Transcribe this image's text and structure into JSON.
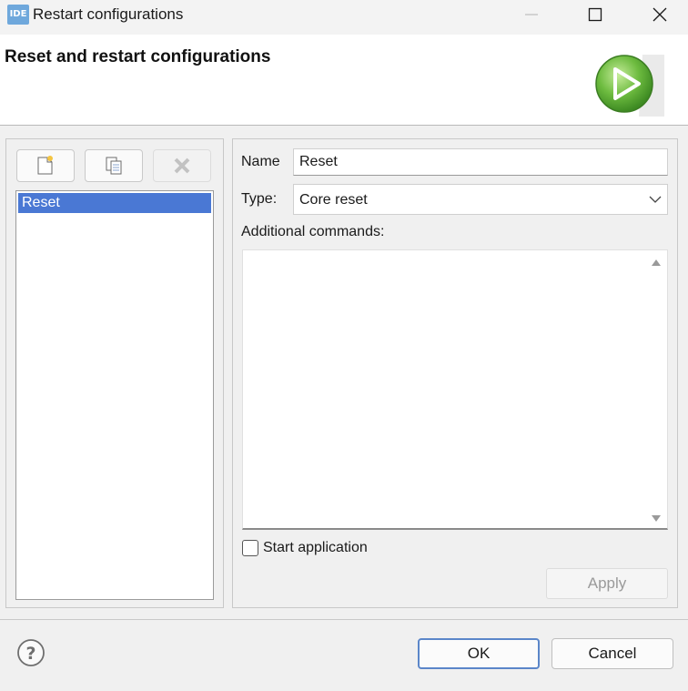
{
  "window": {
    "app_icon_text": "IDE",
    "title": "Restart configurations"
  },
  "header": {
    "title": "Reset and restart configurations",
    "icon": "run-play-icon"
  },
  "toolbar": {
    "new_icon": "new-document-icon",
    "copy_icon": "copy-icon",
    "delete_icon": "delete-x-icon"
  },
  "config_list": {
    "items": [
      {
        "label": "Reset",
        "selected": true
      }
    ]
  },
  "form": {
    "name_label": "Name",
    "name_value": "Reset",
    "type_label": "Type:",
    "type_value": "Core reset",
    "additional_label": "Additional commands:",
    "additional_value": "",
    "start_app_label": "Start application",
    "start_app_checked": false,
    "apply_label": "Apply"
  },
  "footer": {
    "help_icon": "help-icon",
    "ok_label": "OK",
    "cancel_label": "Cancel"
  },
  "colors": {
    "selection": "#4a78d4",
    "ok_border": "#5b86c9",
    "run_icon_green": "#5aa637"
  }
}
